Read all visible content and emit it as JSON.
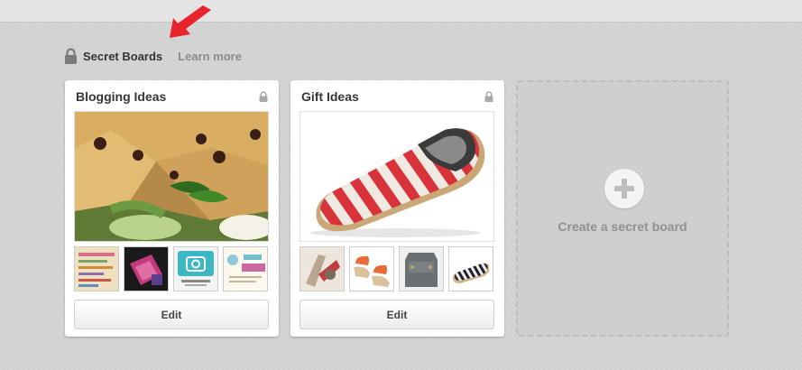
{
  "header": {
    "title": "Secret Boards",
    "learn_more": "Learn more"
  },
  "boards": [
    {
      "name": "Blogging Ideas",
      "edit_label": "Edit"
    },
    {
      "name": "Gift Ideas",
      "edit_label": "Edit"
    }
  ],
  "create": {
    "label": "Create a secret board"
  },
  "colors": {
    "arrow": "#e8232c",
    "background": "#d4d4d4",
    "card": "#ffffff",
    "muted_text": "#8b8b8b"
  }
}
